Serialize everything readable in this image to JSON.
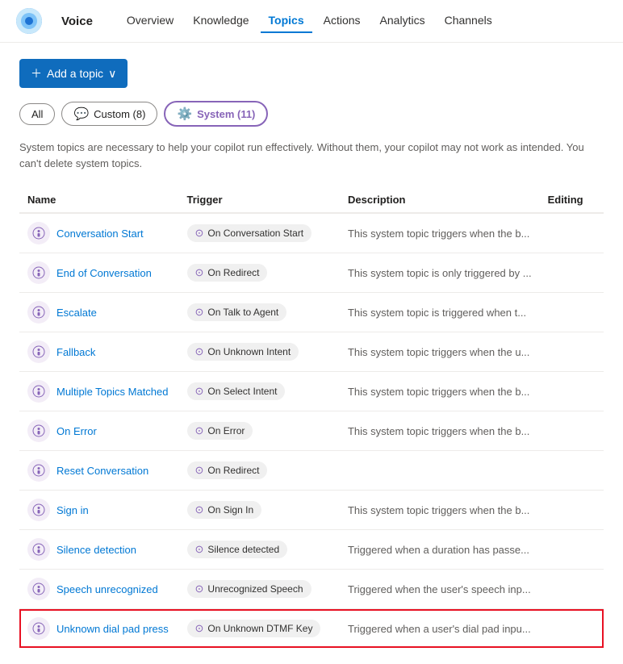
{
  "app": {
    "name": "Voice",
    "logo_alt": "Voice app logo"
  },
  "nav": {
    "links": [
      {
        "label": "Overview",
        "active": false
      },
      {
        "label": "Knowledge",
        "active": false
      },
      {
        "label": "Topics",
        "active": true
      },
      {
        "label": "Actions",
        "active": false
      },
      {
        "label": "Analytics",
        "active": false
      },
      {
        "label": "Channels",
        "active": false
      }
    ]
  },
  "toolbar": {
    "add_topic_label": "+ Add a topic ˅"
  },
  "filters": {
    "all_label": "All",
    "custom_label": "Custom (8)",
    "system_label": "System (11)"
  },
  "info_text": "System topics are necessary to help your copilot run effectively. Without them, your copilot may not work as intended. You can't delete system topics.",
  "table": {
    "headers": [
      "Name",
      "Trigger",
      "Description",
      "Editing"
    ],
    "rows": [
      {
        "name": "Conversation Start",
        "trigger": "On Conversation Start",
        "description": "This system topic triggers when the b..."
      },
      {
        "name": "End of Conversation",
        "trigger": "On Redirect",
        "description": "This system topic is only triggered by ..."
      },
      {
        "name": "Escalate",
        "trigger": "On Talk to Agent",
        "description": "This system topic is triggered when t..."
      },
      {
        "name": "Fallback",
        "trigger": "On Unknown Intent",
        "description": "This system topic triggers when the u..."
      },
      {
        "name": "Multiple Topics Matched",
        "trigger": "On Select Intent",
        "description": "This system topic triggers when the b..."
      },
      {
        "name": "On Error",
        "trigger": "On Error",
        "description": "This system topic triggers when the b..."
      },
      {
        "name": "Reset Conversation",
        "trigger": "On Redirect",
        "description": ""
      },
      {
        "name": "Sign in",
        "trigger": "On Sign In",
        "description": "This system topic triggers when the b..."
      },
      {
        "name": "Silence detection",
        "trigger": "Silence detected",
        "description": "Triggered when a duration has passe..."
      },
      {
        "name": "Speech unrecognized",
        "trigger": "Unrecognized Speech",
        "description": "Triggered when the user's speech inp..."
      },
      {
        "name": "Unknown dial pad press",
        "trigger": "On Unknown DTMF Key",
        "description": "Triggered when a user's dial pad inpu...",
        "highlighted": true
      }
    ]
  }
}
